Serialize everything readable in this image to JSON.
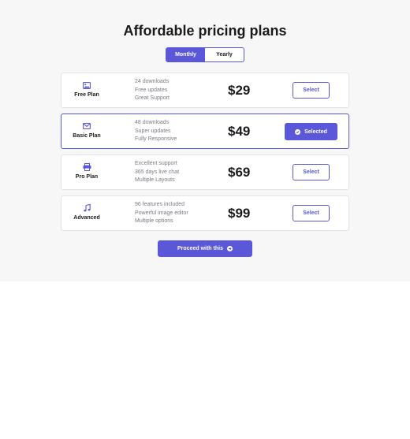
{
  "heading": "Affordable pricing plans",
  "billing_toggle": {
    "options": [
      "Monthly",
      "Yearly"
    ],
    "selected": "Monthly"
  },
  "plans": [
    {
      "name": "Free Plan",
      "icon": "image-icon",
      "features": [
        "24 downloads",
        "Free updates",
        "Great Support"
      ],
      "price": "$29",
      "button_label": "Select",
      "selected": false
    },
    {
      "name": "Basic Plan",
      "icon": "envelope-icon",
      "features": [
        "48 downloads",
        "Super updates",
        "Fully Responsive"
      ],
      "price": "$49",
      "button_label": "Selected",
      "selected": true
    },
    {
      "name": "Pro Plan",
      "icon": "printer-icon",
      "features": [
        "Excellent support",
        "365 days live chat",
        "Multiple Layouts"
      ],
      "price": "$69",
      "button_label": "Select",
      "selected": false
    },
    {
      "name": "Advanced",
      "icon": "music-note-icon",
      "features": [
        "96 features included",
        "Powerful image editor",
        "Multiple options"
      ],
      "price": "$99",
      "button_label": "Select",
      "selected": false
    }
  ],
  "proceed_button": {
    "label": "Proceed with this",
    "icon": "arrow-right-circle-icon"
  },
  "colors": {
    "accent": "#5b57d9",
    "panel_background": "#f7f7f8",
    "muted_text": "#7a7a85"
  }
}
